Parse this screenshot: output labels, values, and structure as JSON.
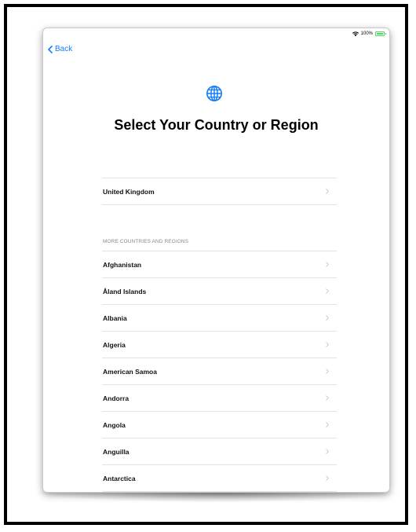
{
  "status_bar": {
    "battery_text": "100%"
  },
  "nav": {
    "back_label": "Back"
  },
  "header": {
    "title": "Select Your Country or Region",
    "icon": "globe-icon"
  },
  "primary_list": [
    {
      "label": "United Kingdom"
    }
  ],
  "section": {
    "header": "MORE COUNTRIES AND REGIONS"
  },
  "countries": [
    {
      "label": "Afghanistan"
    },
    {
      "label": "Åland Islands"
    },
    {
      "label": "Albania"
    },
    {
      "label": "Algeria"
    },
    {
      "label": "American Samoa"
    },
    {
      "label": "Andorra"
    },
    {
      "label": "Angola"
    },
    {
      "label": "Anguilla"
    },
    {
      "label": "Antarctica"
    }
  ],
  "colors": {
    "accent": "#147efb",
    "battery": "#4cd964",
    "divider": "#e3e3e6",
    "section_header": "#8a8a8e"
  }
}
